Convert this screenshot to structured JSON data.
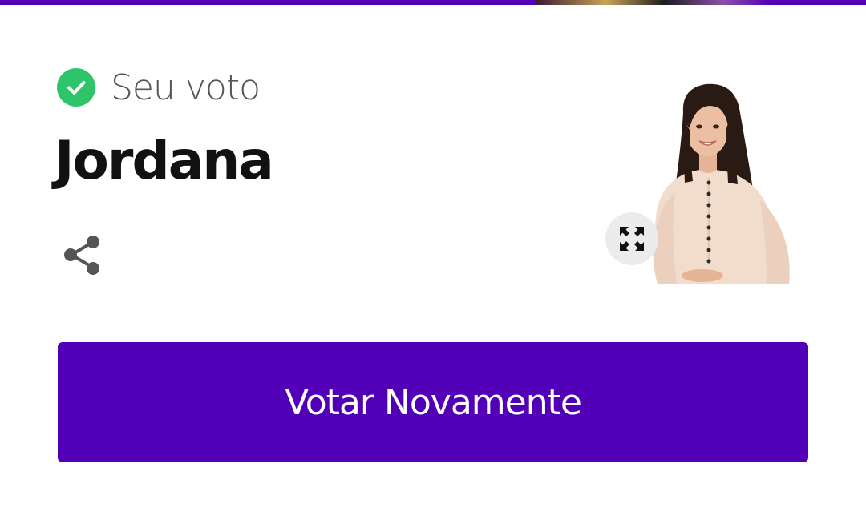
{
  "vote_status": {
    "label": "Seu voto",
    "icon": "check-circle-icon",
    "icon_color": "#2ec56a"
  },
  "candidate": {
    "name": "Jordana",
    "photo_alt": "Jordana"
  },
  "actions": {
    "share_icon": "share-icon",
    "expand_icon": "expand-icon",
    "vote_again_label": "Votar Novamente"
  },
  "colors": {
    "brand": "#5100b8",
    "success": "#2ec56a",
    "text_dark": "#111111",
    "text_muted": "#555555"
  }
}
